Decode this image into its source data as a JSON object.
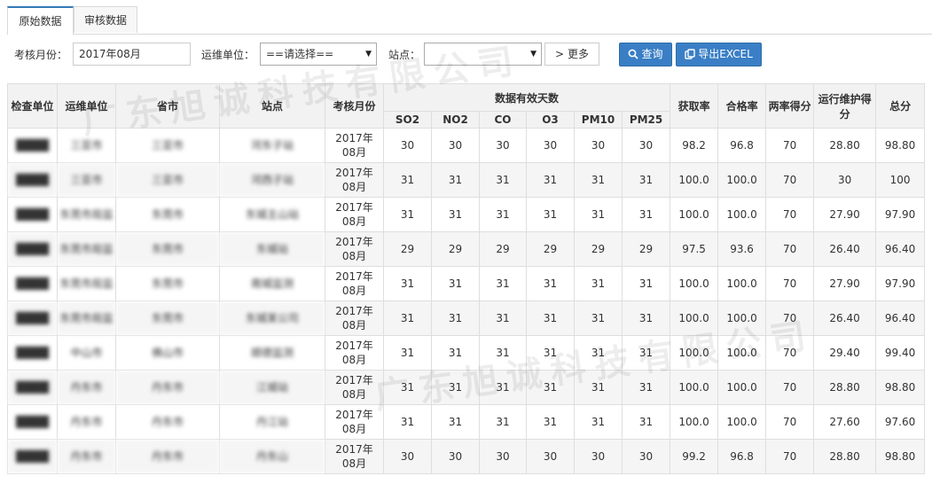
{
  "tabs": [
    {
      "label": "原始数据",
      "active": true
    },
    {
      "label": "审核数据",
      "active": false
    }
  ],
  "filters": {
    "month_label": "考核月份：",
    "month_value": "2017年08月",
    "unit_label": "运维单位：",
    "unit_value": "==请选择==",
    "site_label": "站点：",
    "site_value": "",
    "more_button": "更多",
    "query_button": "查询",
    "export_button": "导出EXCEL"
  },
  "watermark": "广东旭诚科技有限公司",
  "table": {
    "headers": {
      "inspector": "检查单位",
      "maintainer": "运维单位",
      "city": "省市",
      "site": "站点",
      "month": "考核月份",
      "valid_days": "数据有效天数",
      "so2": "SO2",
      "no2": "NO2",
      "co": "CO",
      "o3": "O3",
      "pm10": "PM10",
      "pm25": "PM25",
      "capture_rate": "获取率",
      "pass_rate": "合格率",
      "two_rate_score": "两率得分",
      "ops_score": "运行维护得分",
      "total": "总分"
    },
    "rows": [
      {
        "inspector": "████",
        "maintainer": "三亚市",
        "city": "三亚市",
        "site": "河东子站",
        "month": "2017年08月",
        "so2": "30",
        "no2": "30",
        "co": "30",
        "o3": "30",
        "pm10": "30",
        "pm25": "30",
        "capture": "98.2",
        "pass": "96.8",
        "two_rate": "70",
        "ops": "28.80",
        "total": "98.80"
      },
      {
        "inspector": "████",
        "maintainer": "三亚市",
        "city": "三亚市",
        "site": "河西子站",
        "month": "2017年08月",
        "so2": "31",
        "no2": "31",
        "co": "31",
        "o3": "31",
        "pm10": "31",
        "pm25": "31",
        "capture": "100.0",
        "pass": "100.0",
        "two_rate": "70",
        "ops": "30",
        "total": "100"
      },
      {
        "inspector": "████",
        "maintainer": "东莞市局监",
        "city": "东莞市",
        "site": "东城主山站",
        "month": "2017年08月",
        "so2": "31",
        "no2": "31",
        "co": "31",
        "o3": "31",
        "pm10": "31",
        "pm25": "31",
        "capture": "100.0",
        "pass": "100.0",
        "two_rate": "70",
        "ops": "27.90",
        "total": "97.90"
      },
      {
        "inspector": "████",
        "maintainer": "东莞市局监",
        "city": "东莞市",
        "site": "东城站",
        "month": "2017年08月",
        "so2": "29",
        "no2": "29",
        "co": "29",
        "o3": "29",
        "pm10": "29",
        "pm25": "29",
        "capture": "97.5",
        "pass": "93.6",
        "two_rate": "70",
        "ops": "26.40",
        "total": "96.40"
      },
      {
        "inspector": "████",
        "maintainer": "东莞市局监",
        "city": "东莞市",
        "site": "南城监测",
        "month": "2017年08月",
        "so2": "31",
        "no2": "31",
        "co": "31",
        "o3": "31",
        "pm10": "31",
        "pm25": "31",
        "capture": "100.0",
        "pass": "100.0",
        "two_rate": "70",
        "ops": "27.90",
        "total": "97.90"
      },
      {
        "inspector": "████",
        "maintainer": "东莞市局监",
        "city": "东莞市",
        "site": "东城某公司",
        "month": "2017年08月",
        "so2": "31",
        "no2": "31",
        "co": "31",
        "o3": "31",
        "pm10": "31",
        "pm25": "31",
        "capture": "100.0",
        "pass": "100.0",
        "two_rate": "70",
        "ops": "26.40",
        "total": "96.40"
      },
      {
        "inspector": "████",
        "maintainer": "中山市",
        "city": "佛山市",
        "site": "顺德监测",
        "month": "2017年08月",
        "so2": "31",
        "no2": "31",
        "co": "31",
        "o3": "31",
        "pm10": "31",
        "pm25": "31",
        "capture": "100.0",
        "pass": "100.0",
        "two_rate": "70",
        "ops": "29.40",
        "total": "99.40"
      },
      {
        "inspector": "████",
        "maintainer": "丹东市",
        "city": "丹东市",
        "site": "江城站",
        "month": "2017年08月",
        "so2": "31",
        "no2": "31",
        "co": "31",
        "o3": "31",
        "pm10": "31",
        "pm25": "31",
        "capture": "100.0",
        "pass": "100.0",
        "two_rate": "70",
        "ops": "28.80",
        "total": "98.80"
      },
      {
        "inspector": "████",
        "maintainer": "丹东市",
        "city": "丹东市",
        "site": "丹江站",
        "month": "2017年08月",
        "so2": "31",
        "no2": "31",
        "co": "31",
        "o3": "31",
        "pm10": "31",
        "pm25": "31",
        "capture": "100.0",
        "pass": "100.0",
        "two_rate": "70",
        "ops": "27.60",
        "total": "97.60"
      },
      {
        "inspector": "████",
        "maintainer": "丹东市",
        "city": "丹东市",
        "site": "丹东山",
        "month": "2017年08月",
        "so2": "30",
        "no2": "30",
        "co": "30",
        "o3": "30",
        "pm10": "30",
        "pm25": "30",
        "capture": "99.2",
        "pass": "96.8",
        "two_rate": "70",
        "ops": "28.80",
        "total": "98.80"
      }
    ]
  },
  "colors": {
    "primary_button": "#3a7fc6",
    "active_tab_border": "#337ab7",
    "header_bg": "#f2f2f2"
  }
}
